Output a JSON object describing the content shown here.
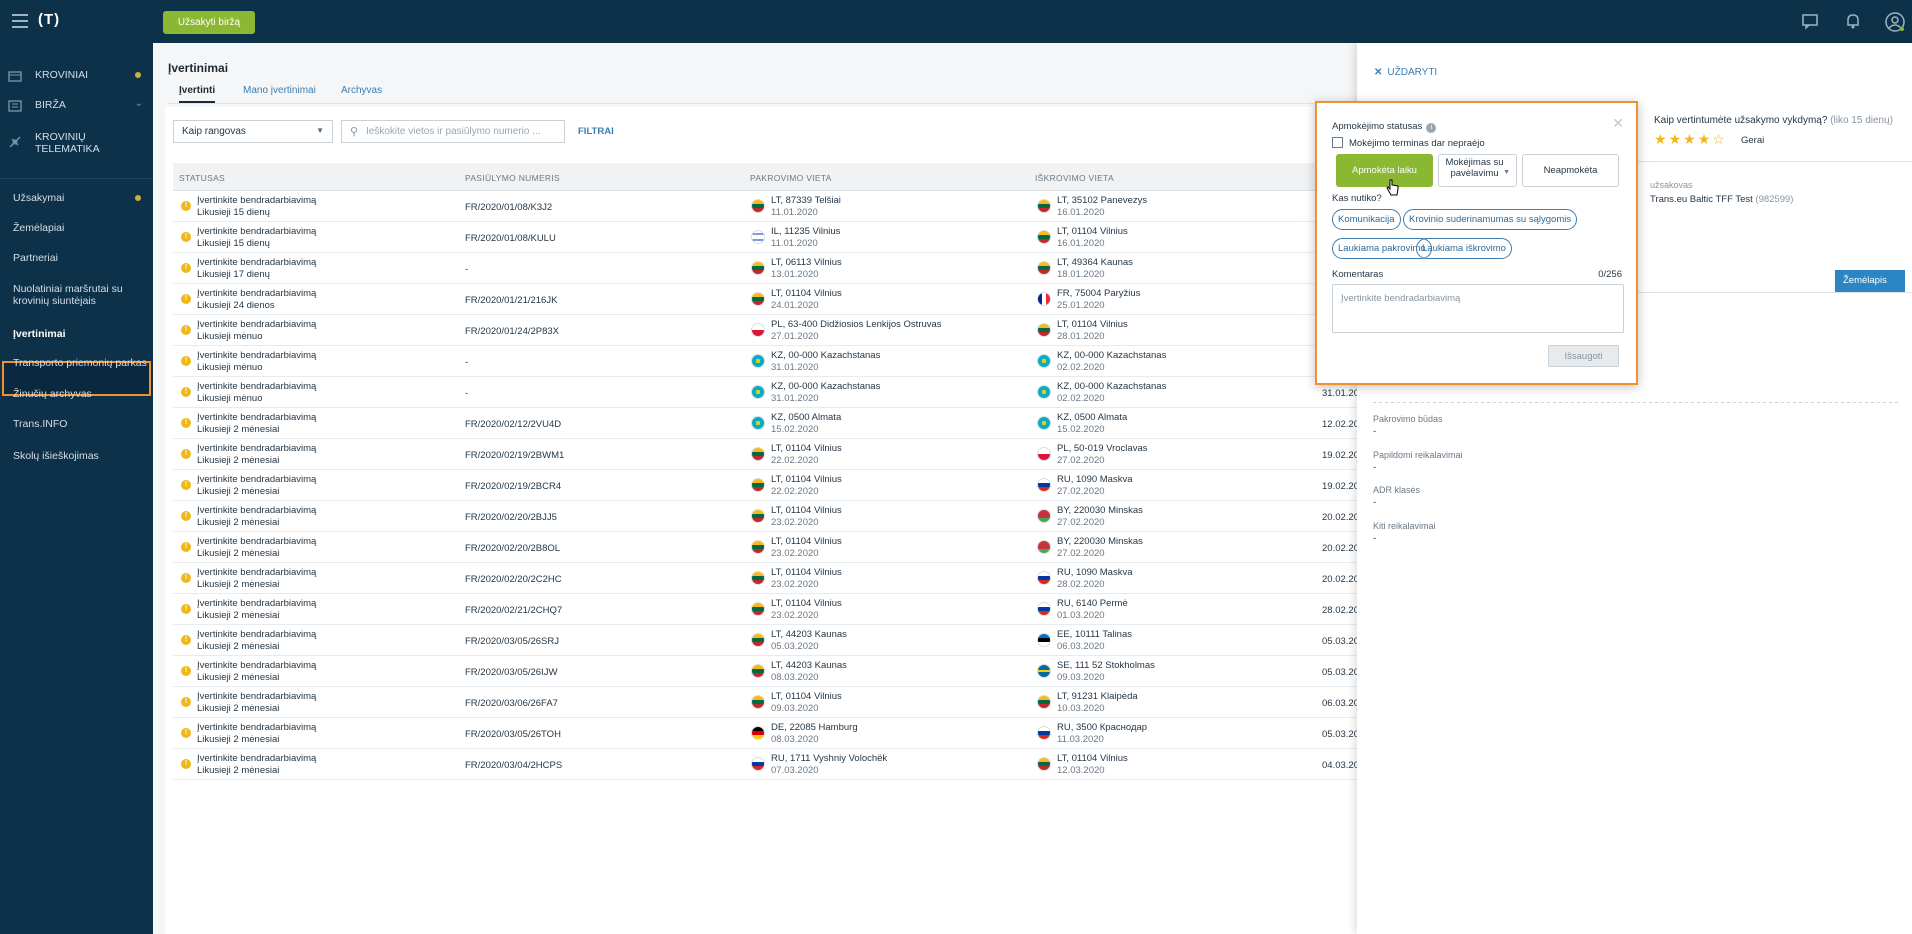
{
  "topbar": {
    "logo": "(T)",
    "order_button": "Užsakyti biržą"
  },
  "sidebar": {
    "groups": [
      {
        "label": "KROVINIAI",
        "icon": "cargo-icon",
        "dot": true
      },
      {
        "label": "BIRŽA",
        "icon": "exchange-icon",
        "chevron": true
      },
      {
        "label": "KROVINIŲ TELEMATIKA",
        "icon": "telematics-icon"
      }
    ],
    "links": [
      "Užsakymai",
      "Žemėlapiai",
      "Partneriai",
      "Nuolatiniai maršrutai su krovinių siuntėjais",
      "Įvertinimai",
      "Transporto priemonių parkas",
      "Žinučių archyvas",
      "Trans.INFO",
      "Skolų išieškojimas"
    ]
  },
  "main": {
    "title": "Įvertinimai",
    "tabs": [
      "Įvertinti",
      "Mano įvertinimai",
      "Archyvas"
    ],
    "role_select": "Kaip rangovas",
    "search_placeholder": "Ieškokite vietos ir pasiūlymo numerio ...",
    "filters": "FILTRAI",
    "columns": [
      "STATUSAS",
      "PASIŪLYMO NUMERIS",
      "PAKROVIMO VIETA",
      "IŠKROVIMO VIETA"
    ],
    "rows": [
      {
        "status": "Įvertinkite bendradarbiavimą",
        "left": "Likusieji 15 dienų",
        "num": "FR/2020/01/08/K3J2",
        "from_flag": "lt",
        "from": "LT, 87339 Telšiai",
        "from_date": "11.01.2020",
        "to_flag": "lt",
        "to": "LT, 35102 Panevezys",
        "to_date": "16.01.2020",
        "date": ""
      },
      {
        "status": "Įvertinkite bendradarbiavimą",
        "left": "Likusieji 15 dienų",
        "num": "FR/2020/01/08/KULU",
        "from_flag": "il",
        "from": "IL, 11235 Vilnius",
        "from_date": "11.01.2020",
        "to_flag": "lt",
        "to": "LT, 01104 Vilnius",
        "to_date": "16.01.2020",
        "date": ""
      },
      {
        "status": "Įvertinkite bendradarbiavimą",
        "left": "Likusieji 17 dienų",
        "num": "-",
        "from_flag": "lt",
        "from": "LT, 06113 Vilnius",
        "from_date": "13.01.2020",
        "to_flag": "lt",
        "to": "LT, 49364 Kaunas",
        "to_date": "18.01.2020",
        "date": ""
      },
      {
        "status": "Įvertinkite bendradarbiavimą",
        "left": "Likusieji 24 dienos",
        "num": "FR/2020/01/21/216JK",
        "from_flag": "lt",
        "from": "LT, 01104 Vilnius",
        "from_date": "24.01.2020",
        "to_flag": "fr",
        "to": "FR, 75004 Paryžius",
        "to_date": "25.01.2020",
        "date": ""
      },
      {
        "status": "Įvertinkite bendradarbiavimą",
        "left": "Likusieji mėnuo",
        "num": "FR/2020/01/24/2P83X",
        "from_flag": "pl",
        "from": "PL, 63-400 Didžiosios Lenkijos Ostruvas",
        "from_date": "27.01.2020",
        "to_flag": "lt",
        "to": "LT, 01104 Vilnius",
        "to_date": "28.01.2020",
        "date": ""
      },
      {
        "status": "Įvertinkite bendradarbiavimą",
        "left": "Likusieji mėnuo",
        "num": "-",
        "from_flag": "kz",
        "from": "KZ, 00-000 Kazachstanas",
        "from_date": "31.01.2020",
        "to_flag": "kz",
        "to": "KZ, 00-000 Kazachstanas",
        "to_date": "02.02.2020",
        "date": "31.01.20"
      },
      {
        "status": "Įvertinkite bendradarbiavimą",
        "left": "Likusieji mėnuo",
        "num": "-",
        "from_flag": "kz",
        "from": "KZ, 00-000 Kazachstanas",
        "from_date": "31.01.2020",
        "to_flag": "kz",
        "to": "KZ, 00-000 Kazachstanas",
        "to_date": "02.02.2020",
        "date": "31.01.20"
      },
      {
        "status": "Įvertinkite bendradarbiavimą",
        "left": "Likusieji 2 mėnesiai",
        "num": "FR/2020/02/12/2VU4D",
        "from_flag": "kz",
        "from": "KZ, 0500 Almata",
        "from_date": "15.02.2020",
        "to_flag": "kz",
        "to": "KZ, 0500 Almata",
        "to_date": "15.02.2020",
        "date": "12.02.20"
      },
      {
        "status": "Įvertinkite bendradarbiavimą",
        "left": "Likusieji 2 mėnesiai",
        "num": "FR/2020/02/19/2BWM1",
        "from_flag": "lt",
        "from": "LT, 01104 Vilnius",
        "from_date": "22.02.2020",
        "to_flag": "pl",
        "to": "PL, 50-019 Vroclavas",
        "to_date": "27.02.2020",
        "date": "19.02.20"
      },
      {
        "status": "Įvertinkite bendradarbiavimą",
        "left": "Likusieji 2 mėnesiai",
        "num": "FR/2020/02/19/2BCR4",
        "from_flag": "lt",
        "from": "LT, 01104 Vilnius",
        "from_date": "22.02.2020",
        "to_flag": "ru",
        "to": "RU, 1090 Maskva",
        "to_date": "27.02.2020",
        "date": "19.02.20"
      },
      {
        "status": "Įvertinkite bendradarbiavimą",
        "left": "Likusieji 2 mėnesiai",
        "num": "FR/2020/02/20/2BJJ5",
        "from_flag": "lt",
        "from": "LT, 01104 Vilnius",
        "from_date": "23.02.2020",
        "to_flag": "by",
        "to": "BY, 220030 Minskas",
        "to_date": "27.02.2020",
        "date": "20.02.20"
      },
      {
        "status": "Įvertinkite bendradarbiavimą",
        "left": "Likusieji 2 mėnesiai",
        "num": "FR/2020/02/20/2B8OL",
        "from_flag": "lt",
        "from": "LT, 01104 Vilnius",
        "from_date": "23.02.2020",
        "to_flag": "by",
        "to": "BY, 220030 Minskas",
        "to_date": "27.02.2020",
        "date": "20.02.20"
      },
      {
        "status": "Įvertinkite bendradarbiavimą",
        "left": "Likusieji 2 mėnesiai",
        "num": "FR/2020/02/20/2C2HC",
        "from_flag": "lt",
        "from": "LT, 01104 Vilnius",
        "from_date": "23.02.2020",
        "to_flag": "ru",
        "to": "RU, 1090 Maskva",
        "to_date": "28.02.2020",
        "date": "20.02.20"
      },
      {
        "status": "Įvertinkite bendradarbiavimą",
        "left": "Likusieji 2 mėnesiai",
        "num": "FR/2020/02/21/2CHQ7",
        "from_flag": "lt",
        "from": "LT, 01104 Vilnius",
        "from_date": "23.02.2020",
        "to_flag": "ru",
        "to": "RU, 6140 Permė",
        "to_date": "01.03.2020",
        "date": "28.02.20"
      },
      {
        "status": "Įvertinkite bendradarbiavimą",
        "left": "Likusieji 2 mėnesiai",
        "num": "FR/2020/03/05/26SRJ",
        "from_flag": "lt",
        "from": "LT, 44203 Kaunas",
        "from_date": "05.03.2020",
        "to_flag": "ee",
        "to": "EE, 10111 Talinas",
        "to_date": "06.03.2020",
        "date": "05.03.20"
      },
      {
        "status": "Įvertinkite bendradarbiavimą",
        "left": "Likusieji 2 mėnesiai",
        "num": "FR/2020/03/05/26IJW",
        "from_flag": "lt",
        "from": "LT, 44203 Kaunas",
        "from_date": "08.03.2020",
        "to_flag": "se",
        "to": "SE, 111 52 Stokholmas",
        "to_date": "09.03.2020",
        "date": "05.03.20"
      },
      {
        "status": "Įvertinkite bendradarbiavimą",
        "left": "Likusieji 2 mėnesiai",
        "num": "FR/2020/03/06/26FA7",
        "from_flag": "lt",
        "from": "LT, 01104 Vilnius",
        "from_date": "09.03.2020",
        "to_flag": "lt",
        "to": "LT, 91231 Klaipėda",
        "to_date": "10.03.2020",
        "date": "06.03.20"
      },
      {
        "status": "Įvertinkite bendradarbiavimą",
        "left": "Likusieji 2 mėnesiai",
        "num": "FR/2020/03/05/26TOH",
        "from_flag": "de",
        "from": "DE, 22085 Hamburg",
        "from_date": "08.03.2020",
        "to_flag": "ru",
        "to": "RU, 3500 Краснодар",
        "to_date": "11.03.2020",
        "date": "05.03.20"
      },
      {
        "status": "Įvertinkite bendradarbiavimą",
        "left": "Likusieji 2 mėnesiai",
        "num": "FR/2020/03/04/2HCPS",
        "from_flag": "ru",
        "from": "RU, 1711 Vyshniy Volochëk",
        "from_date": "07.03.2020",
        "to_flag": "lt",
        "to": "LT, 01104 Vilnius",
        "to_date": "12.03.2020",
        "date": "04.03.20"
      }
    ]
  },
  "panel": {
    "close": "UŽDARYTI",
    "rate_question": "Kaip vertintumėte užsakymo vykdymą?",
    "rate_remaining": "(liko 15 dienų)",
    "stars_value": 4,
    "stars_max": 5,
    "rating_label": "Gerai",
    "customer_label": "užsakovas",
    "customer_name": "Trans.eu Baltic TFF Test",
    "customer_id": "(982599)",
    "map_tab": "Žemėlapis",
    "fields": [
      {
        "label": "Pakrovimo būdas",
        "value": "-"
      },
      {
        "label": "Papildomi reikalavimai",
        "value": "-"
      },
      {
        "label": "ADR klasės",
        "value": "-"
      },
      {
        "label": "Kiti reikalavimai",
        "value": "-"
      }
    ]
  },
  "popup": {
    "title": "Apmokėjimo statusas",
    "checkbox": "Mokėjimo terminas dar nepraėjo",
    "buttons": [
      "Apmokėta laiku",
      "Mokėjimas su pavėlavimu",
      "Neapmokėta"
    ],
    "kas": "Kas nutiko?",
    "chips": [
      "Komunikacija",
      "Krovinio suderinamumas su sąlygomis",
      "Laukiama pakrovimo",
      "Laukiama iškrovimo"
    ],
    "comment_label": "Komentaras",
    "counter": "0/256",
    "comment_placeholder": "Įvertinkite bendradarbiavimą",
    "save": "Išsaugoti"
  },
  "colors": {
    "navy": "#0d3149",
    "green": "#8ab833",
    "orange": "#f0922b",
    "blue": "#2c86c4",
    "warn": "#efb818"
  }
}
